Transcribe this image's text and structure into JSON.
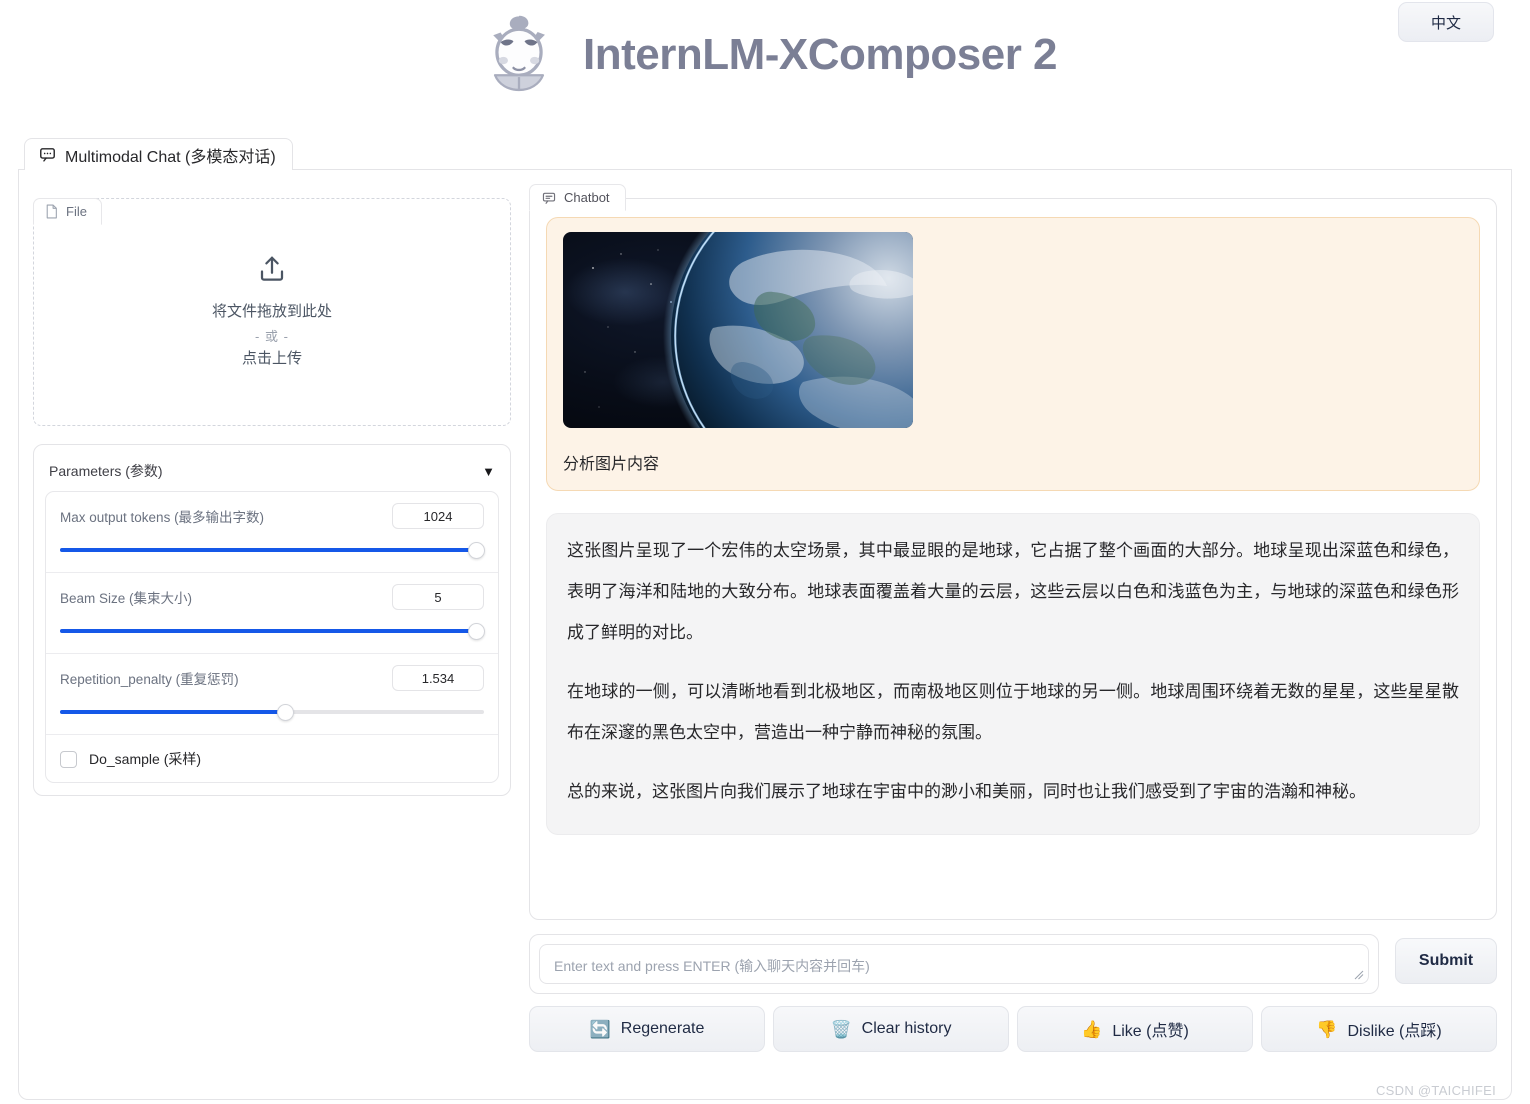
{
  "header": {
    "title": "InternLM-XComposer 2",
    "logo_icon": "mascot-logo-icon",
    "lang_button": "中文"
  },
  "tabs": [
    {
      "label": "Multimodal Chat (多模态对话)",
      "icon": "chat-bubble-icon",
      "selected": true
    }
  ],
  "left_panel": {
    "file_label": "File",
    "file_icon": "document-icon",
    "dropzone": {
      "icon": "upload-icon",
      "drag_text": "将文件拖放到此处",
      "or_text": "- 或 -",
      "click_text": "点击上传"
    },
    "parameters": {
      "title": "Parameters (参数)",
      "caret": "▼",
      "sliders": [
        {
          "label": "Max output tokens (最多输出字数)",
          "value": "1024",
          "percent": 98
        },
        {
          "label": "Beam Size (集束大小)",
          "value": "5",
          "percent": 98
        },
        {
          "label": "Repetition_penalty (重复惩罚)",
          "value": "1.534",
          "percent": 53
        }
      ],
      "checkbox": {
        "label": "Do_sample (采样)",
        "checked": false
      }
    }
  },
  "right_panel": {
    "chatbot_label": "Chatbot",
    "chatbot_icon": "chat-window-icon",
    "messages": [
      {
        "role": "user",
        "image_alt": "earth-from-space-photo",
        "caption": "分析图片内容"
      },
      {
        "role": "assistant",
        "paragraphs": [
          "这张图片呈现了一个宏伟的太空场景，其中最显眼的是地球，它占据了整个画面的大部分。地球呈现出深蓝色和绿色，表明了海洋和陆地的大致分布。地球表面覆盖着大量的云层，这些云层以白色和浅蓝色为主，与地球的深蓝色和绿色形成了鲜明的对比。",
          "在地球的一侧，可以清晰地看到北极地区，而南极地区则位于地球的另一侧。地球周围环绕着无数的星星，这些星星散布在深邃的黑色太空中，营造出一种宁静而神秘的氛围。",
          "总的来说，这张图片向我们展示了地球在宇宙中的渺小和美丽，同时也让我们感受到了宇宙的浩瀚和神秘。"
        ]
      }
    ],
    "input": {
      "value": "",
      "placeholder": "Enter text and press ENTER (输入聊天内容并回车)"
    },
    "submit_label": "Submit",
    "actions": [
      {
        "icon": "🔄",
        "icon_name": "regenerate-icon",
        "label": "Regenerate"
      },
      {
        "icon": "🗑️",
        "icon_name": "trash-icon",
        "label": "Clear history"
      },
      {
        "icon": "👍",
        "icon_name": "thumbs-up-icon",
        "label": "Like (点赞)"
      },
      {
        "icon": "👎",
        "icon_name": "thumbs-down-icon",
        "label": "Dislike (点踩)"
      }
    ]
  },
  "watermark": "CSDN @TAICHIFEI",
  "colors": {
    "accent_blue": "#1558e8",
    "user_bubble_bg": "#fdf3e7",
    "user_bubble_border": "#f5d9b4",
    "bot_bubble_bg": "#f4f4f5",
    "title_gray": "#7b7f95"
  }
}
